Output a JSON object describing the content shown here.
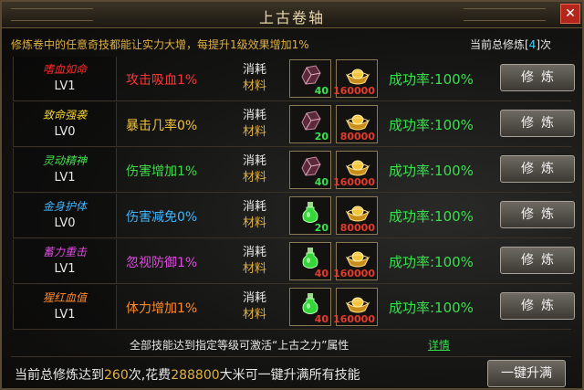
{
  "window": {
    "title": "上古卷轴",
    "close_label": "✕"
  },
  "header": {
    "info": "修炼卷中的任意奇技都能让实力大增，每提升1级效果增加1%",
    "count_prefix": "当前总修炼[",
    "count_value": "4",
    "count_suffix": "]次"
  },
  "consume": {
    "line1": "消耗",
    "line2": "材料"
  },
  "train_label": "修炼",
  "rows": [
    {
      "name": "嗜血如命",
      "name_color": "#ff2a2a",
      "level": "LV1",
      "effect": "攻击吸血1%",
      "effect_color": "#ff3535",
      "material": "crystal",
      "material_qty": "40",
      "material_qty_color": "green",
      "gold_qty": "160000",
      "gold_qty_color": "red",
      "rate": "成功率:100%"
    },
    {
      "name": "致命强袭",
      "name_color": "#f3d12f",
      "level": "LV0",
      "effect": "暴击几率0%",
      "effect_color": "#f0c23a",
      "material": "crystal",
      "material_qty": "20",
      "material_qty_color": "green",
      "gold_qty": "80000",
      "gold_qty_color": "red",
      "rate": "成功率:100%"
    },
    {
      "name": "灵动精神",
      "name_color": "#43e04b",
      "level": "LV1",
      "effect": "伤害增加1%",
      "effect_color": "#3fdc49",
      "material": "crystal",
      "material_qty": "40",
      "material_qty_color": "green",
      "gold_qty": "160000",
      "gold_qty_color": "red",
      "rate": "成功率:100%"
    },
    {
      "name": "金身护体",
      "name_color": "#3fb6ff",
      "level": "LV0",
      "effect": "伤害减免0%",
      "effect_color": "#3fb6ff",
      "material": "potion",
      "material_qty": "20",
      "material_qty_color": "green",
      "gold_qty": "80000",
      "gold_qty_color": "red",
      "rate": "成功率:100%"
    },
    {
      "name": "蓄力重击",
      "name_color": "#e04be0",
      "level": "LV1",
      "effect": "忽视防御1%",
      "effect_color": "#e24ae2",
      "material": "potion",
      "material_qty": "40",
      "material_qty_color": "red",
      "gold_qty": "160000",
      "gold_qty_color": "red",
      "rate": "成功率:100%"
    },
    {
      "name": "猩红血值",
      "name_color": "#ff8a2a",
      "level": "LV1",
      "effect": "体力增加1%",
      "effect_color": "#ff8a2a",
      "material": "potion",
      "material_qty": "40",
      "material_qty_color": "red",
      "gold_qty": "160000",
      "gold_qty_color": "red",
      "rate": "成功率:100%"
    }
  ],
  "footer": {
    "note": "全部技能达到指定等级可激活“上古之力”属性",
    "detail_link": "详情",
    "bottom_prefix": "当前总修炼达到",
    "bottom_times": "260",
    "bottom_mid": "次,花费",
    "bottom_cost": "288800",
    "bottom_suffix": "大米可一键升满所有技能",
    "oneclick_label": "一键升满"
  },
  "icons": {
    "material": [
      "crystal-icon",
      "potion-icon"
    ],
    "gold": "gold-ingot-icon",
    "close": "close-icon"
  }
}
